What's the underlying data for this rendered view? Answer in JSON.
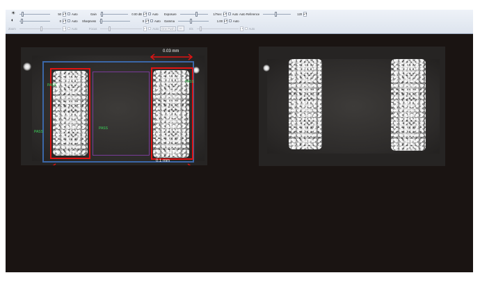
{
  "toolbar": {
    "brightness": {
      "value": "50",
      "auto_label": "Auto",
      "level": 0.08
    },
    "contrast": {
      "value": "0",
      "auto_label": "Auto",
      "level": 0.05
    },
    "gain": {
      "label": "Gain",
      "value": "0.00 dB",
      "auto_label": "Auto",
      "level": 0.02
    },
    "sharpness": {
      "label": "Sharpness",
      "value": "0",
      "auto_label": "Auto",
      "level": 0.02
    },
    "exposure": {
      "label": "Exposure",
      "value": "1/7sec",
      "auto_label": "Auto",
      "level": 0.6
    },
    "gamma": {
      "label": "Gamma",
      "value": "1.00",
      "auto_label": "Auto",
      "level": 0.42
    },
    "auto_reference": {
      "label": "Auto Reference",
      "value": "120",
      "level": 0.45
    },
    "zoom": {
      "label": "Zoom",
      "auto_label": "Auto"
    },
    "focus": {
      "label": "Focus",
      "auto_label": "Auto",
      "onepush_label": "One Push"
    },
    "iris": {
      "label": "Iris",
      "auto_label": "Auto"
    }
  },
  "viewer": {
    "measurement_top": "0.03 mm",
    "measurement_bottom": "0.1 mm",
    "roi_labels": {
      "left_electrode": "PASS",
      "right_electrode": "PASS",
      "center": "PASS",
      "outer": "PASS"
    }
  },
  "colors": {
    "background": "#1a1412",
    "roi_electrode": "#e01313",
    "roi_outer": "#3b67a8",
    "roi_center": "#7a3c9a",
    "pass_text": "#3cd65b",
    "measurement_line": "#e01313"
  }
}
